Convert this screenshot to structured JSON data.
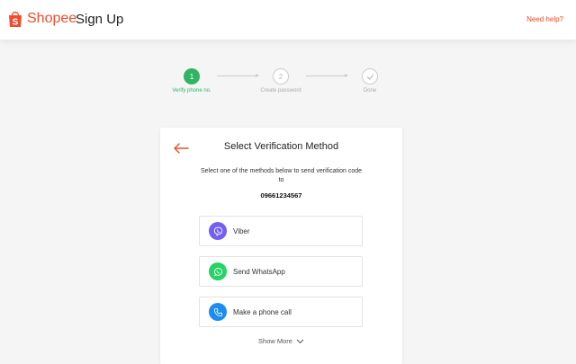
{
  "header": {
    "brand": "Shopee",
    "title": "Sign Up",
    "help_link": "Need help?",
    "brand_color": "#ee4d2d"
  },
  "stepper": {
    "steps": [
      {
        "number": "1",
        "label": "Verify phone no.",
        "state": "active"
      },
      {
        "number": "2",
        "label": "Create password",
        "state": "inactive"
      },
      {
        "number": "",
        "label": "Done",
        "state": "inactive",
        "icon": "check-icon"
      }
    ],
    "active_color": "#30b566"
  },
  "card": {
    "title": "Select Verification Method",
    "description": "Select one of the methods below to send verification code to",
    "phone_number": "09661234567",
    "methods": [
      {
        "label": "Viber",
        "icon": "viber-icon",
        "color": "#7360f2"
      },
      {
        "label": "Send WhatsApp",
        "icon": "whatsapp-icon",
        "color": "#25d366"
      },
      {
        "label": "Make a phone call",
        "icon": "phone-icon",
        "color": "#1c8cf2"
      }
    ],
    "show_more": "Show More"
  }
}
